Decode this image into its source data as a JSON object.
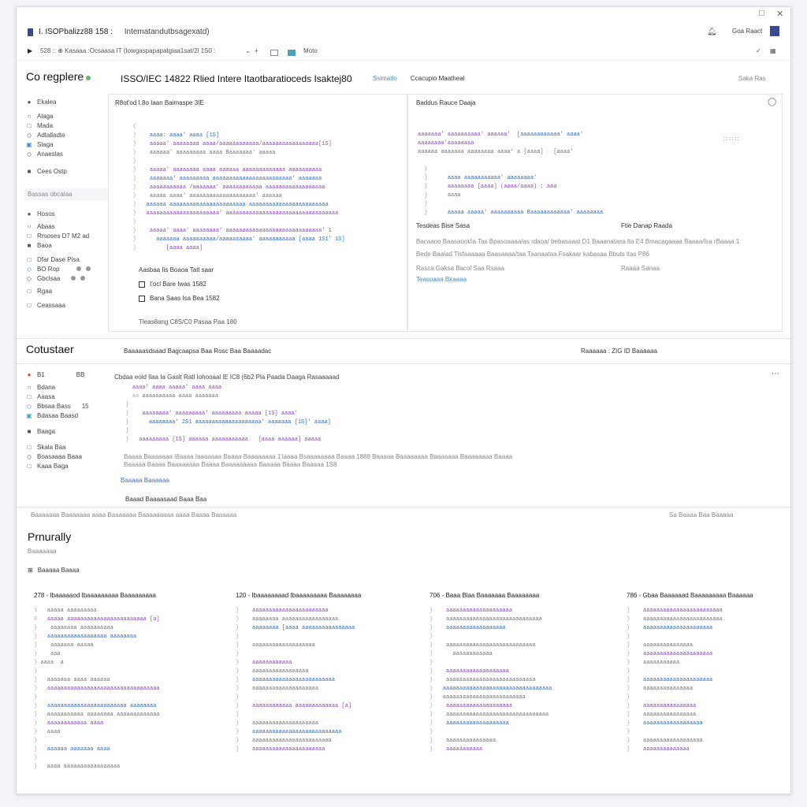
{
  "window": {
    "controls": [
      "□",
      "✕"
    ]
  },
  "appbar": {
    "title": "I. ISOPbalizz88 158 :",
    "subtitle": "Intematandutbsagexatd)",
    "user_label": "Goa Raact"
  },
  "toolbar": {
    "path": "528 :: ⊕ Kasaaa :Ocsaasa IT (Iowgaspapapatgiaa1sat/2l 1S0 :",
    "view_label": "Moto"
  },
  "section1": {
    "title": "Co regplere",
    "heading": "ISSO/IEC 14822 Rlied Intere Itaotbaratioceds Isaktej80",
    "heading_tag": "Ssimatlo",
    "heading_extra": "Ccacupio Maatheal",
    "right_link": "Saka Ras",
    "sidebar": [
      {
        "icon": "●",
        "label": "Ekalea"
      },
      {
        "icon": "○",
        "label": "Alaga"
      },
      {
        "icon": "□",
        "label": "Mada"
      },
      {
        "icon": "◇",
        "label": "Adtalladte"
      },
      {
        "icon": "▣",
        "label": "Slaga"
      },
      {
        "icon": "◇",
        "label": "Anaeslas"
      },
      {
        "icon": "■",
        "label": "Cees Ostp"
      }
    ],
    "sidebar_group": "Bassas obcalaa",
    "sidebar2": [
      {
        "icon": "●",
        "label": "Hosos"
      },
      {
        "icon": "○",
        "label": "Abaas"
      },
      {
        "icon": "□",
        "label": "Rmoses D7 M2 ad"
      },
      {
        "icon": "■",
        "label": "Baoa"
      },
      {
        "icon": "□",
        "label": "Dfar Dase Pisa"
      },
      {
        "icon": "◇",
        "label": "BO Rop"
      },
      {
        "icon": "◇",
        "label": "Gbclsaa"
      },
      {
        "icon": "□",
        "label": "Rgaa"
      },
      {
        "icon": "□",
        "label": "Ceassaaa"
      }
    ],
    "panel_left_title": "R8ot'od I.8o  Iaan Baimaspe  3IE",
    "panel_left_foot_title": "Aasbaa Iis Boaoa Tatl saar",
    "panel_left_item1": "I'ocl Bare Iwas 1582",
    "panel_left_item2": "Bana Saas Isa Bea 1582",
    "panel_left_status": "Tleas8ang C8S/C0 Pasaa Paa 180",
    "panel_right_title": "Baddus Rauce Daaja",
    "panel_right_sub1": "Tesdeas Bise Sasa",
    "panel_right_sub2": "Ftie Danap Raada",
    "panel_right_lines": [
      "Bacaaoo Baasaoot/ia Tas Bpasoaaaa/as rdaoa/ bebasaaat D1 Baaanatasa lta E4 Bmacagaaaa Baaaa/lsa rBaaaa 1",
      "Bede Baalad Tlsfaaaaaa Baasaaaa/taa Taanaataa Fsakaar kabasaa Bbuts ltas P86",
      "Rasca Gaksa Bacol Saa Rsaaa",
      "Raaaa Sanaa",
      "Teasoaaa Bkaaaa"
    ]
  },
  "section2": {
    "title": "Cotustaer",
    "header_text": "Baaaaasdsaad Bagcaapsa Baa Rosc Baa Baaaadac",
    "header_right": "Raaaaaa : ZIG ID Baaaaaa",
    "sidebar": [
      {
        "icon": "●",
        "label": "B1",
        "extra": "BB"
      },
      {
        "icon": "○",
        "label": "Bdana"
      },
      {
        "icon": "□",
        "label": "Aaasa"
      },
      {
        "icon": "◇",
        "label": "Bbsaa Bass",
        "extra": "15"
      },
      {
        "icon": "▣",
        "label": "Bdasaa Baasd"
      },
      {
        "icon": "■",
        "label": "Baaga"
      },
      {
        "icon": "□",
        "label": "Skala Baa"
      },
      {
        "icon": "◇",
        "label": "Boasaaaa Baaa"
      },
      {
        "icon": "□",
        "label": "Kaaa Baga"
      }
    ],
    "main_title": "Cbdaa eoid Ilaa Ia Gaslt Ratl Iohooaal lE IC8 (6b2 Pla Paada Daaga Rasaaaaad",
    "line_a": "Baaaa Baaaaaaa I8aaaa Iaaaaaaa Baaaa Baaaaaaaa 1'laaaa Bsaaaaaaaa Baaaa 1888 Baaaaa Baaaaaaaa Baaaaaaa Baaaaaaaa Baaaa",
    "line_b": "Baaaaa Baaaa Baaaaaaaa Baaaa Baaaaaaaaa Baaaaa Baaaa Baaaaa 1S8",
    "footer_left": "Baaaaa Baaaaaa",
    "footer_text": "Baaad Baaaasaad Baaa Baa",
    "status": "Baaaaaaa Baaaaaaa aaaa Baaaaaaa Baaaaaaaaa aaaa Baaaa Baaaaaa",
    "status_right": "Sa Baaaa  Baa   Baaaaa"
  },
  "section3": {
    "title": "Prnurally",
    "subtitle": "Baaaaaaa",
    "filter": "Baaaaa Baaaa",
    "columns": [
      {
        "head": "278 - Ibaaaaaod Ibaaaaaaaaa Baaaaaaaaa"
      },
      {
        "head": "120 - Ibaaaaaaaad Ibaaaaaaaaa Baaaaaaaa"
      },
      {
        "head": "706 - Baaa Blaa Baaaaaaa Baaaaaaaa"
      },
      {
        "head": "786 - Gbaa Baaaaaad Baaaaaaaaa Baaaaaa"
      }
    ]
  }
}
